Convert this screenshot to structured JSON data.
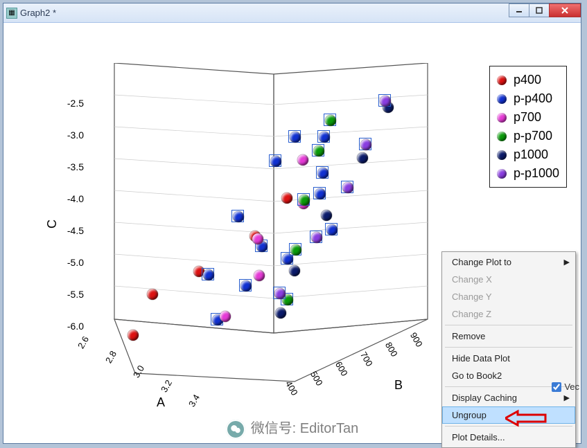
{
  "window": {
    "title": "Graph2 *"
  },
  "tabs": {
    "active": "1"
  },
  "legend": {
    "items": [
      {
        "label": "p400",
        "color": "#d11"
      },
      {
        "label": "p-p400",
        "color": "#1131d1"
      },
      {
        "label": "p700",
        "color": "#e53ad6"
      },
      {
        "label": "p-p700",
        "color": "#0a9b0a"
      },
      {
        "label": "p1000",
        "color": "#0b1b6b"
      },
      {
        "label": "p-p1000",
        "color": "#8a3de0"
      }
    ]
  },
  "axes": {
    "c": {
      "label": "C",
      "ticks": [
        "-2.5",
        "-3.0",
        "-3.5",
        "-4.0",
        "-4.5",
        "-5.0",
        "-5.5",
        "-6.0"
      ]
    },
    "a": {
      "label": "A",
      "ticks": [
        "2.6",
        "2.8",
        "3.0",
        "3.2",
        "3.4"
      ]
    },
    "b": {
      "label": "B",
      "ticks": [
        "400",
        "500",
        "600",
        "700",
        "800",
        "900"
      ]
    }
  },
  "chart_data": {
    "type": "scatter",
    "title": "",
    "axes": {
      "x": {
        "label": "A",
        "range": [
          2.6,
          3.4
        ]
      },
      "y": {
        "label": "B",
        "range": [
          400,
          900
        ]
      },
      "z": {
        "label": "C",
        "range": [
          -6.0,
          -2.5
        ]
      }
    },
    "series": [
      {
        "name": "p400",
        "color": "#d11",
        "boxed": false,
        "points": [
          {
            "a": 2.72,
            "b": 520,
            "c": -4.0
          },
          {
            "a": 2.95,
            "b": 560,
            "c": -4.5
          },
          {
            "a": 3.1,
            "b": 470,
            "c": -5.0
          },
          {
            "a": 3.28,
            "b": 430,
            "c": -5.3
          },
          {
            "a": 3.35,
            "b": 410,
            "c": -5.9
          }
        ]
      },
      {
        "name": "p-p400",
        "color": "#1131d1",
        "boxed": true,
        "points": [
          {
            "a": 2.62,
            "b": 480,
            "c": -3.1
          },
          {
            "a": 2.8,
            "b": 530,
            "c": -3.4
          },
          {
            "a": 2.68,
            "b": 610,
            "c": -3.6
          },
          {
            "a": 2.95,
            "b": 500,
            "c": -4.2
          },
          {
            "a": 3.05,
            "b": 640,
            "c": -4.6
          },
          {
            "a": 3.2,
            "b": 560,
            "c": -5.0
          },
          {
            "a": 2.85,
            "b": 720,
            "c": -3.0
          },
          {
            "a": 3.0,
            "b": 800,
            "c": -3.8
          },
          {
            "a": 3.25,
            "b": 850,
            "c": -4.7
          },
          {
            "a": 3.38,
            "b": 700,
            "c": -5.6
          },
          {
            "a": 3.34,
            "b": 770,
            "c": -5.1
          },
          {
            "a": 3.1,
            "b": 900,
            "c": -4.3
          }
        ]
      },
      {
        "name": "p700",
        "color": "#e53ad6",
        "boxed": false,
        "points": [
          {
            "a": 2.78,
            "b": 610,
            "c": -3.4
          },
          {
            "a": 2.92,
            "b": 700,
            "c": -4.0
          },
          {
            "a": 3.08,
            "b": 650,
            "c": -4.5
          },
          {
            "a": 3.2,
            "b": 730,
            "c": -5.0
          },
          {
            "a": 3.3,
            "b": 680,
            "c": -5.6
          }
        ]
      },
      {
        "name": "p-p700",
        "color": "#0a9b0a",
        "boxed": true,
        "points": [
          {
            "a": 2.72,
            "b": 660,
            "c": -2.8
          },
          {
            "a": 2.88,
            "b": 720,
            "c": -3.2
          },
          {
            "a": 3.02,
            "b": 760,
            "c": -3.9
          },
          {
            "a": 3.16,
            "b": 820,
            "c": -4.6
          },
          {
            "a": 3.3,
            "b": 880,
            "c": -5.3
          }
        ]
      },
      {
        "name": "p1000",
        "color": "#0b1b6b",
        "boxed": false,
        "points": [
          {
            "a": 2.7,
            "b": 840,
            "c": -2.6
          },
          {
            "a": 2.9,
            "b": 880,
            "c": -3.3
          },
          {
            "a": 3.12,
            "b": 900,
            "c": -4.1
          },
          {
            "a": 3.24,
            "b": 870,
            "c": -4.9
          },
          {
            "a": 3.36,
            "b": 900,
            "c": -5.5
          }
        ]
      },
      {
        "name": "p-p1000",
        "color": "#8a3de0",
        "boxed": true,
        "points": [
          {
            "a": 2.66,
            "b": 800,
            "c": -2.5
          },
          {
            "a": 2.84,
            "b": 850,
            "c": -3.1
          },
          {
            "a": 3.0,
            "b": 890,
            "c": -3.7
          },
          {
            "a": 3.18,
            "b": 900,
            "c": -4.4
          },
          {
            "a": 3.34,
            "b": 880,
            "c": -5.2
          }
        ]
      }
    ]
  },
  "context_menu": {
    "items": [
      {
        "label": "Change Plot to",
        "enabled": true,
        "submenu": true
      },
      {
        "label": "Change X",
        "enabled": false
      },
      {
        "label": "Change Y",
        "enabled": false
      },
      {
        "label": "Change Z",
        "enabled": false
      },
      {
        "sep": true
      },
      {
        "label": "Remove",
        "enabled": true
      },
      {
        "sep": true
      },
      {
        "label": "Hide Data Plot",
        "enabled": true
      },
      {
        "label": "Go to Book2",
        "enabled": true
      },
      {
        "sep": true
      },
      {
        "label": "Display Caching",
        "enabled": true,
        "submenu": true
      },
      {
        "label": "Ungroup",
        "enabled": true,
        "hover": true
      },
      {
        "sep": true
      },
      {
        "label": "Plot Details...",
        "enabled": true
      }
    ]
  },
  "side_checkbox": {
    "label": "Vec",
    "checked": true
  },
  "watermark": "微信号: EditorTan"
}
